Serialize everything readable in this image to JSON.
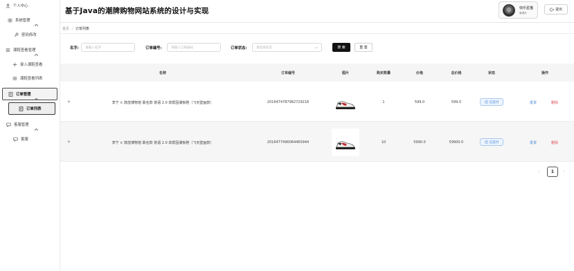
{
  "header": {
    "title": "基于Java的潮牌购物网站系统的设计与实现",
    "user_name": "快乐星猫",
    "user_role": "管理员",
    "logout_label": "退出"
  },
  "sidebar": {
    "items": [
      {
        "label": "个人中心",
        "icon": "user-icon"
      },
      {
        "label": "系统管理",
        "icon": "gear-icon"
      },
      {
        "label": "密码修改",
        "icon": "key-icon"
      },
      {
        "label": "潮鞋查看管理",
        "icon": "menu-icon"
      },
      {
        "label": "录入潮鞋查看",
        "icon": "plus-icon"
      },
      {
        "label": "潮鞋查看列表",
        "icon": "list-icon"
      },
      {
        "label": "订单管理",
        "icon": "order-icon"
      },
      {
        "label": "订单列表",
        "icon": "order-icon"
      },
      {
        "label": "客服管理",
        "icon": "chat-icon"
      },
      {
        "label": "客服",
        "icon": "chat-icon"
      }
    ]
  },
  "breadcrumb": {
    "home": "首页",
    "separator": "/",
    "current": "订单列表"
  },
  "search": {
    "name_label": "名字:",
    "name_placeholder": "请输入名字",
    "order_no_label": "订单编号:",
    "order_no_placeholder": "请输入订单编号",
    "status_label": "订单状态:",
    "status_placeholder": "请选择状态",
    "search_button": "搜 索",
    "reset_button": "重 置"
  },
  "table": {
    "columns": [
      "名称",
      "订单编号",
      "图片",
      "购买数量",
      "价格",
      "总价格",
      "状态",
      "操作"
    ],
    "rows": [
      {
        "expand": "+",
        "name": "李宁 × 敦煌博物馆 联名款 箭语 2.0 高帮固潮板鞋（飞天壁画款）",
        "order_no": "2016474787982729216",
        "quantity": "1",
        "price": "599.0",
        "total": "599.0",
        "status": "已支付",
        "ship": "发货",
        "delete": "删除"
      },
      {
        "expand": "+",
        "name": "李宁 × 敦煌博物馆 联名款 箭语 2.0 高帮固潮板鞋（飞天壁画款）",
        "order_no": "2016477496064465944",
        "quantity": "10",
        "price": "5990.0",
        "total": "59900.0",
        "status": "已支付",
        "ship": "发货",
        "delete": "删除"
      }
    ]
  },
  "pagination": {
    "prev": "‹",
    "current_page": "1",
    "next": "›"
  },
  "colors": {
    "primary_button": "#111111",
    "status_blue": "#3f82d4",
    "delete_red": "#e0555b"
  }
}
